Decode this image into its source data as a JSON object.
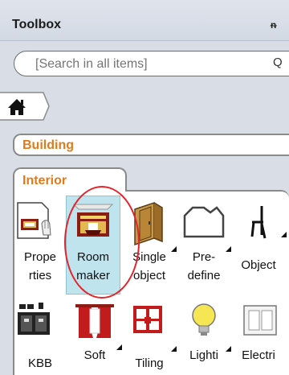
{
  "toolbox": {
    "title": "Toolbox",
    "pin_glyph": "ᵰ"
  },
  "search": {
    "placeholder": "[Search in all items]",
    "button": "Q"
  },
  "breadcrumb": {
    "home_icon": "home-icon"
  },
  "categories": {
    "building": "Building",
    "interior": "Interior"
  },
  "items": [
    {
      "label": "Prope\nrties",
      "icon": "properties-icon"
    },
    {
      "label": "Room\nmaker",
      "icon": "room-maker-icon",
      "selected": true
    },
    {
      "label": "Single\nobject",
      "icon": "single-object-icon"
    },
    {
      "label": "Pre-\ndefine",
      "icon": "predefine-icon"
    },
    {
      "label": "Object",
      "icon": "object-chair-icon"
    },
    {
      "label": "KBB",
      "icon": "kbb-icon"
    },
    {
      "label": "Soft",
      "icon": "soft-furnishing-icon"
    },
    {
      "label": "Tiling",
      "icon": "tiling-icon"
    },
    {
      "label": "Lighti",
      "icon": "lighting-icon"
    },
    {
      "label": "Electri",
      "icon": "electrical-icon"
    }
  ]
}
